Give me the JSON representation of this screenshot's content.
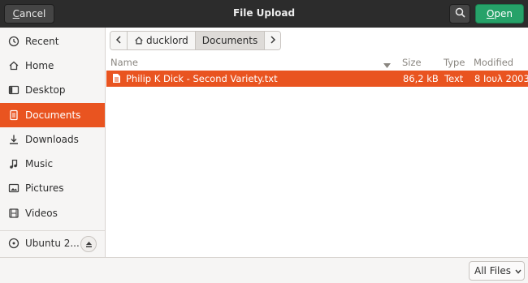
{
  "header": {
    "title": "File Upload",
    "cancel_label": "Cancel",
    "open_label": "Open"
  },
  "sidebar": {
    "items": [
      {
        "label": "Recent",
        "icon": "clock-icon"
      },
      {
        "label": "Home",
        "icon": "home-icon"
      },
      {
        "label": "Desktop",
        "icon": "desktop-icon"
      },
      {
        "label": "Documents",
        "icon": "document-icon",
        "active": true
      },
      {
        "label": "Downloads",
        "icon": "download-icon"
      },
      {
        "label": "Music",
        "icon": "music-icon"
      },
      {
        "label": "Pictures",
        "icon": "picture-icon"
      },
      {
        "label": "Videos",
        "icon": "video-icon"
      }
    ],
    "volume": {
      "label": "Ubuntu 2...",
      "icon": "disk-icon",
      "eject_icon": "eject-icon"
    }
  },
  "pathbar": {
    "segments": [
      "ducklord",
      "Documents"
    ]
  },
  "columns": {
    "name": "Name",
    "size": "Size",
    "type": "Type",
    "modified": "Modified"
  },
  "files": [
    {
      "name": "Philip K Dick - Second Variety.txt",
      "size": "86,2 kB",
      "type": "Text",
      "modified": "8 Ιουλ 2003"
    }
  ],
  "footer": {
    "filter_label": "All Files"
  },
  "colors": {
    "accent": "#e95420",
    "open_button": "#26a269",
    "header_bg": "#2c2c2c"
  }
}
